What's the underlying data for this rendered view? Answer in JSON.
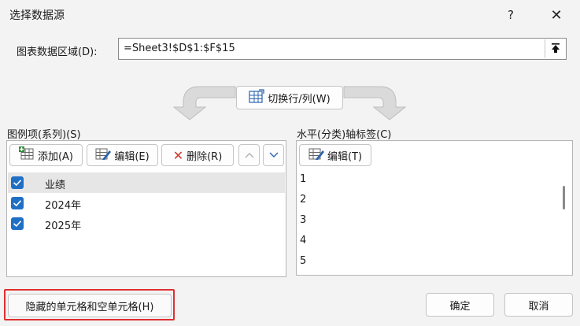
{
  "dialog": {
    "title": "选择数据源",
    "help_symbol": "?",
    "close_symbol": "✕"
  },
  "range": {
    "label": "图表数据区域(D):",
    "value": "=Sheet3!$D$1:$F$15",
    "collapse_icon": "collapse-arrow-icon"
  },
  "switch_button": {
    "label": "切换行/列(W)"
  },
  "legend": {
    "section_label": "图例项(系列)(S)",
    "toolbar": {
      "add_label": "添加(A)",
      "edit_label": "编辑(E)",
      "delete_label": "删除(R)"
    },
    "items": [
      {
        "label": "业绩",
        "checked": true,
        "selected": true
      },
      {
        "label": "2024年",
        "checked": true,
        "selected": false
      },
      {
        "label": "2025年",
        "checked": true,
        "selected": false
      }
    ]
  },
  "axis": {
    "section_label": "水平(分类)轴标签(C)",
    "edit_label": "编辑(T)",
    "items": [
      "1",
      "2",
      "3",
      "4",
      "5"
    ]
  },
  "footer": {
    "hidden_cells_label": "隐藏的单元格和空单元格(H)",
    "ok_label": "确定",
    "cancel_label": "取消"
  },
  "colors": {
    "accent": "#1f6fc5",
    "highlight": "#e03030",
    "delete_red": "#d0342c"
  }
}
